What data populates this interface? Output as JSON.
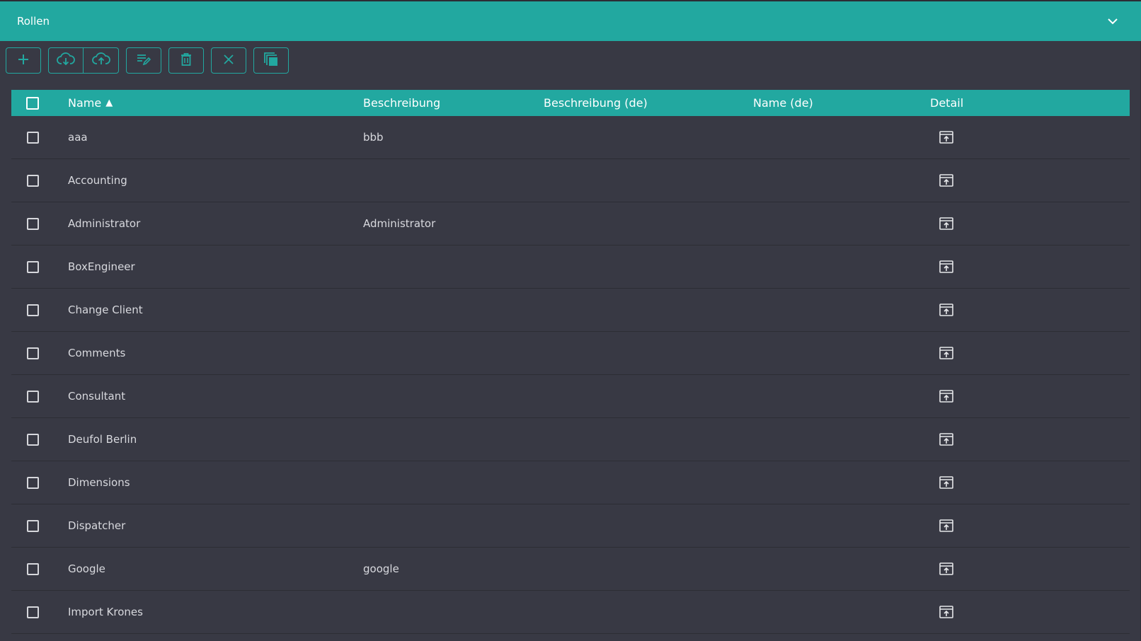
{
  "panel": {
    "title": "Rollen",
    "collapse_icon": "chevron-down-icon"
  },
  "toolbar": {
    "buttons": [
      {
        "name": "add-button",
        "icon": "plus-icon"
      },
      {
        "name": "download-button",
        "icon": "cloud-download-icon"
      },
      {
        "name": "upload-button",
        "icon": "cloud-upload-icon"
      },
      {
        "name": "edit-button",
        "icon": "edit-list-icon"
      },
      {
        "name": "delete-button",
        "icon": "trash-icon"
      },
      {
        "name": "cancel-button",
        "icon": "close-icon"
      },
      {
        "name": "copy-button",
        "icon": "copy-icon"
      }
    ]
  },
  "table": {
    "columns": {
      "name": "Name",
      "sort_indicator": "▲",
      "description": "Beschreibung",
      "description_de": "Beschreibung (de)",
      "name_de": "Name (de)",
      "detail": "Detail"
    },
    "rows": [
      {
        "name": "aaa",
        "description": "bbb",
        "description_de": "",
        "name_de": ""
      },
      {
        "name": "Accounting",
        "description": "",
        "description_de": "",
        "name_de": ""
      },
      {
        "name": "Administrator",
        "description": "Administrator",
        "description_de": "",
        "name_de": ""
      },
      {
        "name": "BoxEngineer",
        "description": "",
        "description_de": "",
        "name_de": ""
      },
      {
        "name": "Change Client",
        "description": "",
        "description_de": "",
        "name_de": ""
      },
      {
        "name": "Comments",
        "description": "",
        "description_de": "",
        "name_de": ""
      },
      {
        "name": "Consultant",
        "description": "",
        "description_de": "",
        "name_de": ""
      },
      {
        "name": "Deufol Berlin",
        "description": "",
        "description_de": "",
        "name_de": ""
      },
      {
        "name": "Dimensions",
        "description": "",
        "description_de": "",
        "name_de": ""
      },
      {
        "name": "Dispatcher",
        "description": "",
        "description_de": "",
        "name_de": ""
      },
      {
        "name": "Google",
        "description": "google",
        "description_de": "",
        "name_de": ""
      },
      {
        "name": "Import Krones",
        "description": "",
        "description_de": "",
        "name_de": ""
      }
    ]
  },
  "colors": {
    "accent": "#22a8a0",
    "background": "#383944",
    "row_divider": "#2c2d34",
    "text": "#d8d9de"
  }
}
